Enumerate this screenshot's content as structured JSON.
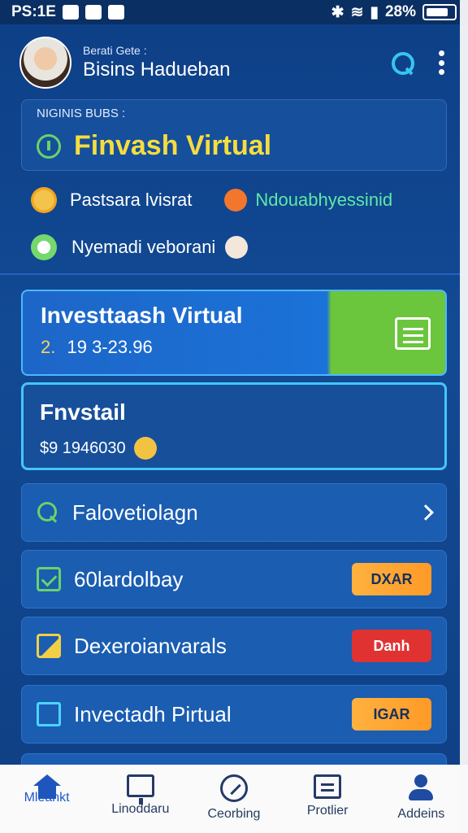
{
  "status_bar": {
    "time": "PS:1E",
    "battery": "28%"
  },
  "header": {
    "subtitle": "Berati Gete :",
    "title": "Bisins Hadueban"
  },
  "balance": {
    "label": "NIGINIS BUBS :",
    "value": "Finvash Virtual"
  },
  "info_rows": [
    {
      "left": "Pastsara lvisrat",
      "right": "Ndouabhyessinid"
    },
    {
      "left": "Nyemadi veborani"
    }
  ],
  "cards": {
    "investment": {
      "title": "Investtaash Virtual",
      "prefix": "2.",
      "amount": "19 3-23.96"
    },
    "funds": {
      "title": "Fnvstail",
      "amount": "$9 1946030"
    }
  },
  "menu": [
    {
      "label": "Falovetiolagn",
      "icon": "search-icon",
      "accent": "#69d36a"
    },
    {
      "label": "60lardolbay",
      "icon": "check-icon",
      "badge": "DXAR",
      "badge_color": "#ffb13f"
    },
    {
      "label": "Dexeroianvarals",
      "icon": "board-icon",
      "badge": "Danh",
      "badge_color": "#e13232"
    },
    {
      "label": "Invectadh Pirtual",
      "icon": "file-icon",
      "badge": "IGAR",
      "badge_color": "#ffb13f"
    }
  ],
  "bottom_nav": [
    {
      "label": "Mleankt",
      "icon": "home-icon",
      "active": true
    },
    {
      "label": "Linoddaru",
      "icon": "monitor-icon",
      "active": false
    },
    {
      "label": "Ceorbing",
      "icon": "compass-icon",
      "active": false
    },
    {
      "label": "Protlier",
      "icon": "document-icon",
      "active": false
    },
    {
      "label": "Addeins",
      "icon": "user-icon",
      "active": false
    }
  ],
  "colors": {
    "background": "#124a94",
    "accent_yellow": "#f6dd3f",
    "accent_green": "#69d36a",
    "accent_cyan": "#45c5ff"
  }
}
